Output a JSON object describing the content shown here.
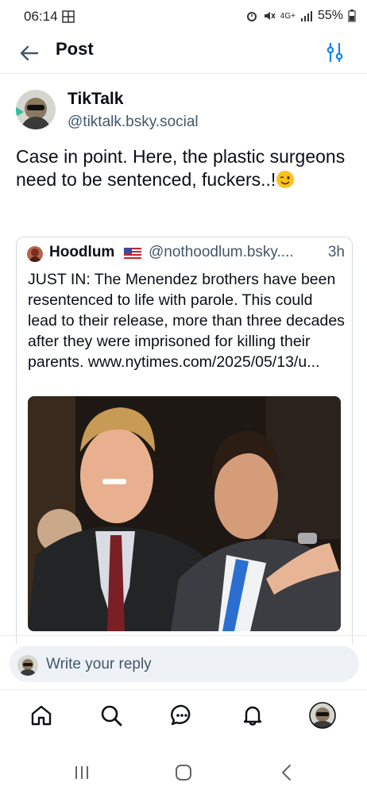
{
  "status_bar": {
    "time": "06:14",
    "network": "4G+",
    "battery": "55%"
  },
  "header": {
    "title": "Post",
    "back_icon": "arrow-left-icon",
    "sort_icon": "sliders-icon"
  },
  "post": {
    "display_name": "TikTalk",
    "handle": "@tiktalk.bsky.social",
    "text": "Case in point. Here, the plastic surgeons need to be sentenced, fuckers..!",
    "emoji": "winking-face-emoji"
  },
  "quote": {
    "display_name": "Hoodlum",
    "handle": "@nothoodlum.bsky....",
    "time": "3h",
    "text": "JUST IN: The Menendez brothers have been resentenced to life with parole. This could lead to their release, more than three decades after they were imprisoned for killing their parents. www.nytimes.com/2025/05/13/u..."
  },
  "reply": {
    "placeholder": "Write your reply"
  },
  "nav": {
    "items": [
      "home-icon",
      "search-icon",
      "chat-icon",
      "bell-icon",
      "profile-avatar"
    ]
  },
  "colors": {
    "accent": "#1083fe",
    "muted_text": "#42576c",
    "border": "#d4dbe2"
  }
}
